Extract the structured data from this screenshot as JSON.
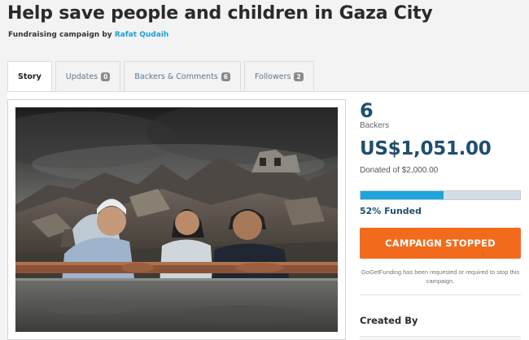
{
  "campaign": {
    "title": "Help save people and children in Gaza City",
    "byline_prefix": "Fundraising campaign by",
    "author": "Rafat Qudaih"
  },
  "tabs": [
    {
      "label": "Story",
      "active": true
    },
    {
      "label": "Updates",
      "count": "0"
    },
    {
      "label": "Backers & Comments",
      "count": "6"
    },
    {
      "label": "Followers",
      "count": "2"
    }
  ],
  "stats": {
    "backers_count": "6",
    "backers_label": "Backers",
    "amount_raised": "US$1,051.00",
    "goal_text": "Donated of $2,000.00",
    "percent_funded": 52,
    "funded_text": "52% Funded"
  },
  "status": {
    "button_label": "CAMPAIGN STOPPED",
    "notice": "GoGetFunding has been requested or required to stop this campaign."
  },
  "creator": {
    "heading": "Created By"
  },
  "colors": {
    "accent_blue": "#1ea6dc",
    "dark_blue": "#1e4f70",
    "stopped_orange": "#f26b1d",
    "link": "#1a9fd9"
  }
}
